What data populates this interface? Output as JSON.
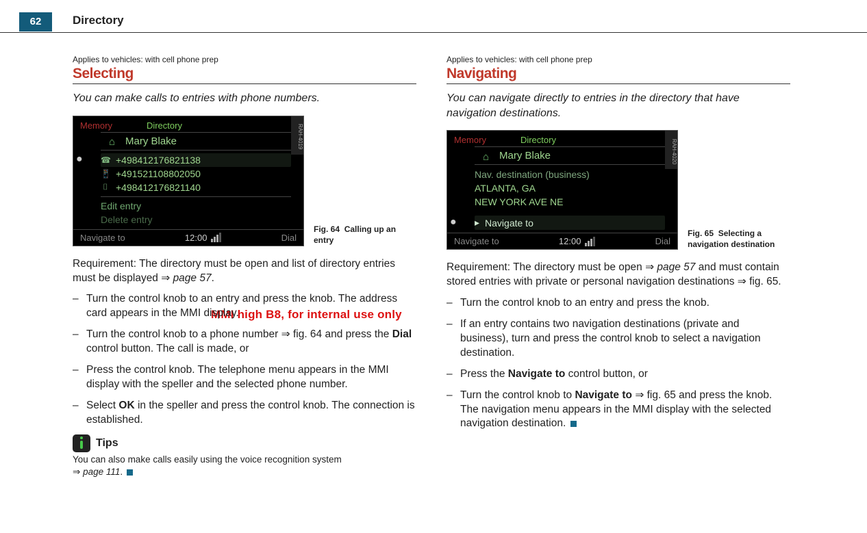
{
  "page": {
    "number": "62",
    "header": "Directory"
  },
  "watermark": "MMI high B8, for internal use only",
  "left": {
    "applies": "Applies to vehicles: with cell phone prep",
    "heading": "Selecting",
    "lead": "You can make calls to entries with phone numbers.",
    "fig": {
      "memory": "Memory",
      "directory": "Directory",
      "sideTag": "RAH-4019",
      "name": "Mary Blake",
      "lines": [
        "+498412176821138",
        "+491521108802050",
        "+498412176821140"
      ],
      "edit": "Edit entry",
      "delete": "Delete entry",
      "navTo": "Navigate to",
      "time": "12:00",
      "dial": "Dial",
      "caption_num": "Fig. 64",
      "caption_txt": "Calling up an entry"
    },
    "req_a": "Requirement: The directory must be open and list of direc­tory entries must be displayed ",
    "req_ref": "page 57",
    "b1a": "Turn the control knob to an entry and press the knob. The address card appears in the MMI display.",
    "b2a": "Turn the control knob to a phone number ",
    "b2b": " fig. 64 and press the ",
    "b2c": "Dial",
    "b2d": " control button. The call is made, or",
    "b3": "Press the control knob. The telephone menu appears in the MMI display with the speller and the selected phone number.",
    "b4a": "Select ",
    "b4b": "OK",
    "b4c": " in the speller and press the control knob. The connection is established.",
    "tipsLabel": "Tips",
    "tipsText_a": "You can also make calls easily using the voice recognition system ",
    "tipsRef": "page 111",
    "period": "."
  },
  "right": {
    "applies": "Applies to vehicles: with cell phone prep",
    "heading": "Navigating",
    "lead": "You can navigate directly to entries in the directory that have navigation destinations.",
    "fig": {
      "memory": "Memory",
      "directory": "Directory",
      "sideTag": "RAH-4020",
      "name": "Mary Blake",
      "dest": "Nav. destination (business)",
      "city": "ATLANTA, GA",
      "street": "NEW YORK AVE NE",
      "navSel": "Navigate to",
      "navTo": "Navigate to",
      "time": "12:00",
      "dial": "Dial",
      "caption_num": "Fig. 65",
      "caption_txt": "Selecting a navigation destination"
    },
    "req_a": "Requirement: The directory must be open ",
    "req_ref": "page 57",
    "req_b": " and must contain stored entries with private or personal naviga­tion destinations ",
    "req_c": " fig. 65.",
    "b1": "Turn the control knob to an entry and press the knob.",
    "b2": "If an entry contains two navigation destinations (private and business), turn and press the control knob to select a navigation destination.",
    "b3a": "Press the ",
    "b3b": "Navigate to",
    "b3c": " control button, or",
    "b4a": "Turn the control knob to ",
    "b4b": "Navigate to",
    "b4c": " ",
    "b4d": " fig. 65 and press the knob. The navigation menu appears in the MMI display with the selected navigation destination."
  },
  "glyph": {
    "arrow": "⇒",
    "dash": "–",
    "bullet": "•",
    "tri": "▸"
  }
}
